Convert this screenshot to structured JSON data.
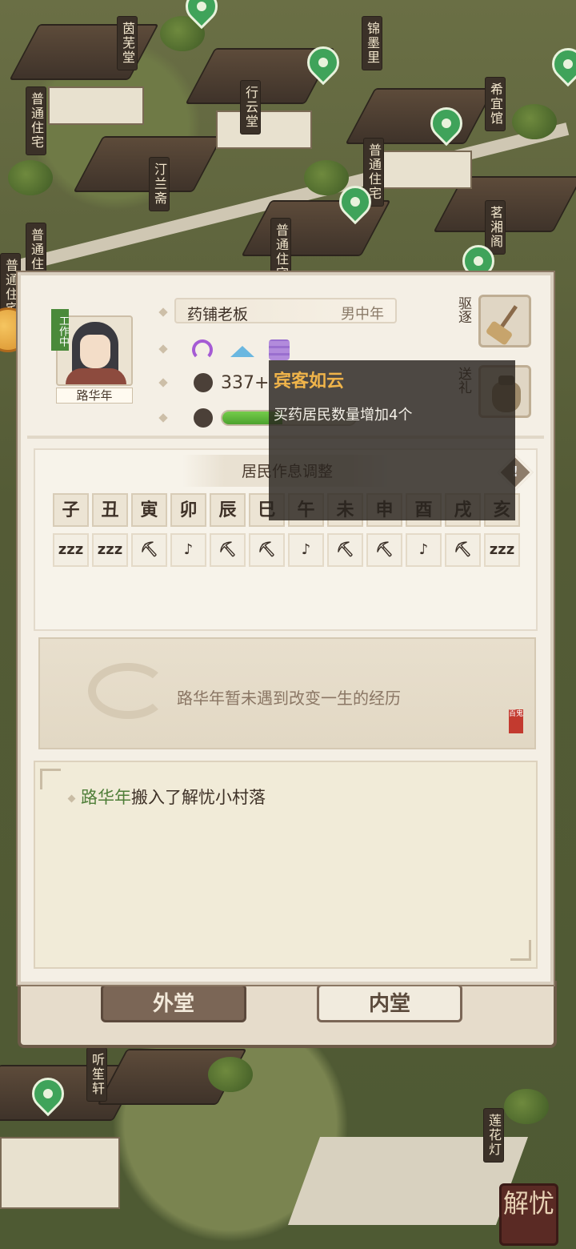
{
  "map": {
    "signs": [
      "茵芜堂",
      "锦墨里",
      "普通住宅",
      "行云堂",
      "希宜馆",
      "普通住宅",
      "汀兰斋",
      "普通住宅",
      "茗湘阁",
      "普通住宅",
      "普通住宅",
      "听笙轩",
      "莲花灯"
    ]
  },
  "character": {
    "status_tag": "工作中",
    "name": "路华年",
    "role": "药铺老板",
    "age_group": "男中年",
    "money": "337+",
    "health_percent": 45
  },
  "actions": {
    "expel_label": "驱逐",
    "gift_label": "送礼"
  },
  "tooltip": {
    "title": "宾客如云",
    "text": "买药居民数量增加4个"
  },
  "schedule": {
    "title": "居民作息调整",
    "hours": [
      "子",
      "丑",
      "寅",
      "卯",
      "辰",
      "巳",
      "午",
      "未",
      "申",
      "酉",
      "戌",
      "亥"
    ],
    "activities": [
      "zzz",
      "zzz",
      "⛏",
      "♪",
      "⛏",
      "⛏",
      "♪",
      "⛏",
      "⛏",
      "♪",
      "⛏",
      "zzz"
    ]
  },
  "experience": {
    "text": "路华年暂未遇到改变一生的经历",
    "seal": "百鬼"
  },
  "log": {
    "entries": [
      {
        "who": "路华年",
        "what": "搬入了解忧小村落"
      }
    ]
  },
  "tabs": {
    "outer": "外堂",
    "inner": "内堂"
  },
  "corner_button": "解忧"
}
